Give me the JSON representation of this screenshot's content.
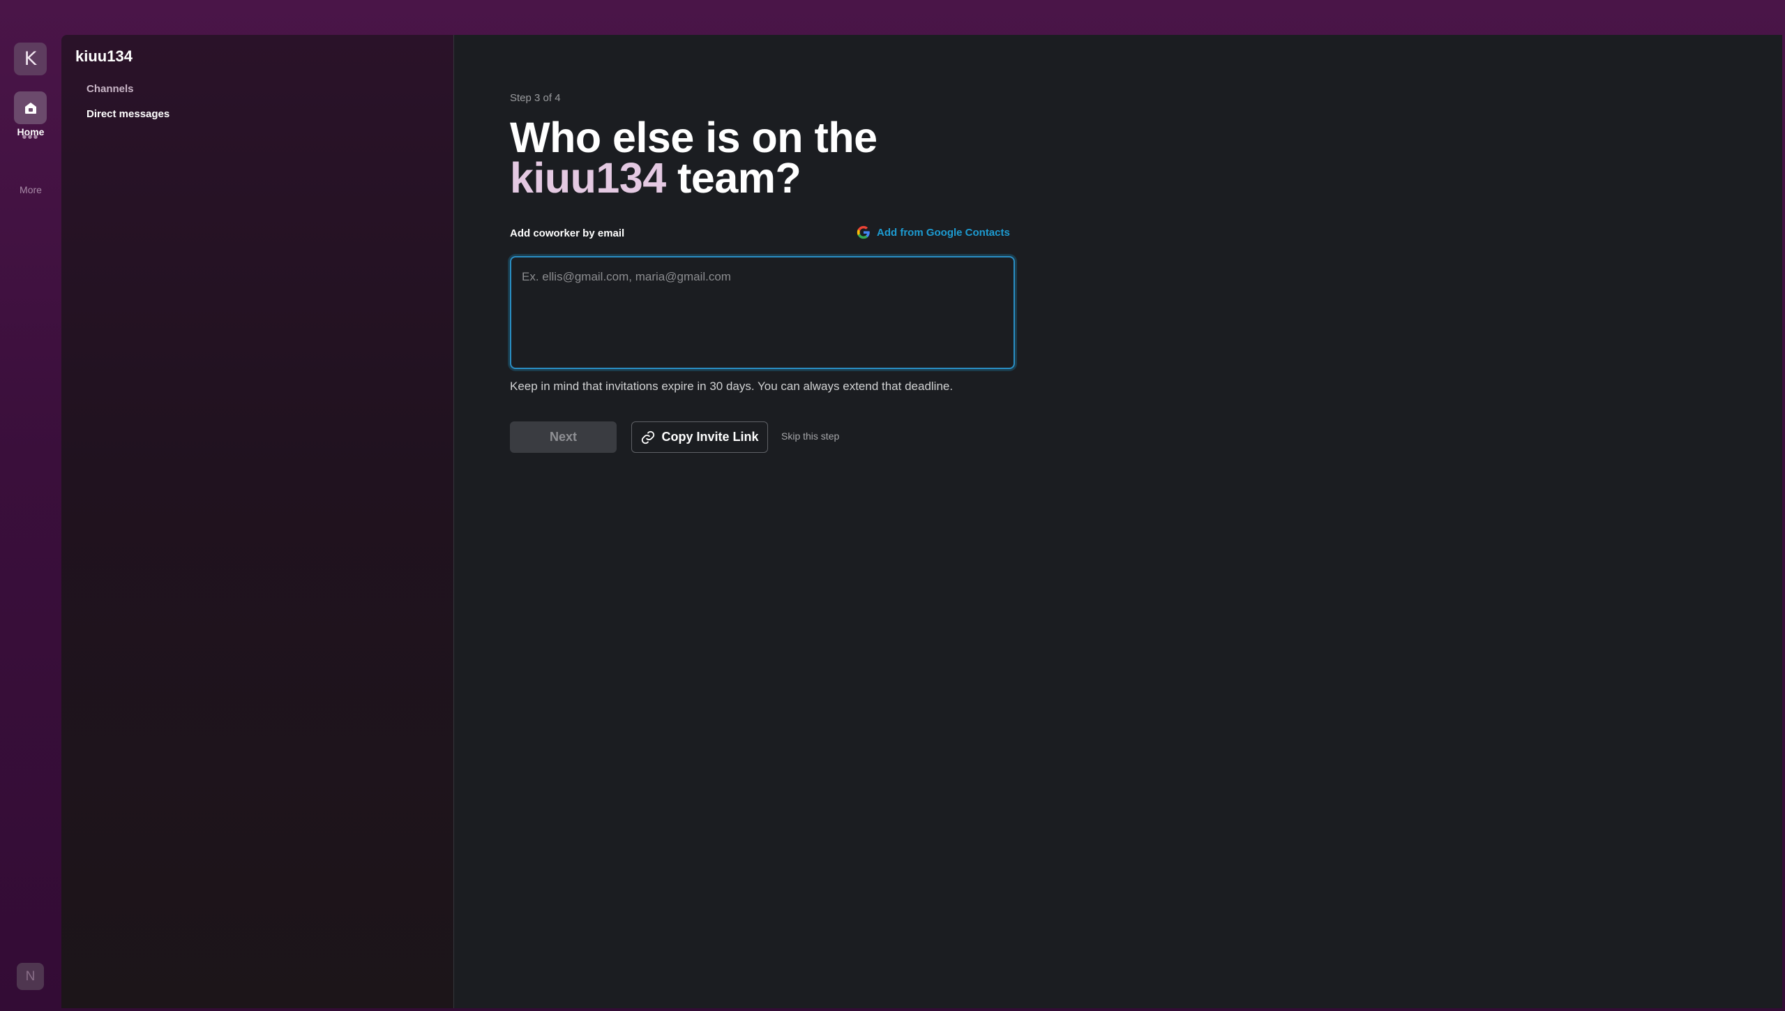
{
  "rail": {
    "workspace_initial": "K",
    "home_label": "Home",
    "home_icon": "home-icon",
    "more_glyph": "•••",
    "more_label": "More",
    "user_initial": "N"
  },
  "sidebar": {
    "workspace_name": "kiuu134",
    "items": [
      {
        "label": "Channels"
      },
      {
        "label": "Direct messages"
      }
    ]
  },
  "main": {
    "step": "Step 3 of 4",
    "headline_line1": "Who else is on the",
    "headline_team": "kiuu134",
    "headline_suffix": " team?",
    "field_label": "Add coworker by email",
    "google_link": "Add from Google Contacts",
    "google_icon": "google-icon",
    "email_placeholder": "Ex. ellis@gmail.com, maria@gmail.com",
    "hint": "Keep in mind that invitations expire in 30 days. You can always extend that deadline.",
    "next_label": "Next",
    "copy_label": "Copy Invite Link",
    "copy_icon": "link-icon",
    "skip_label": "Skip this step"
  },
  "colors": {
    "accent": "#1d9bd1",
    "team_name": "#e4c9e2",
    "background": "#1b1d21",
    "sidebar_top": "#2a1229"
  }
}
